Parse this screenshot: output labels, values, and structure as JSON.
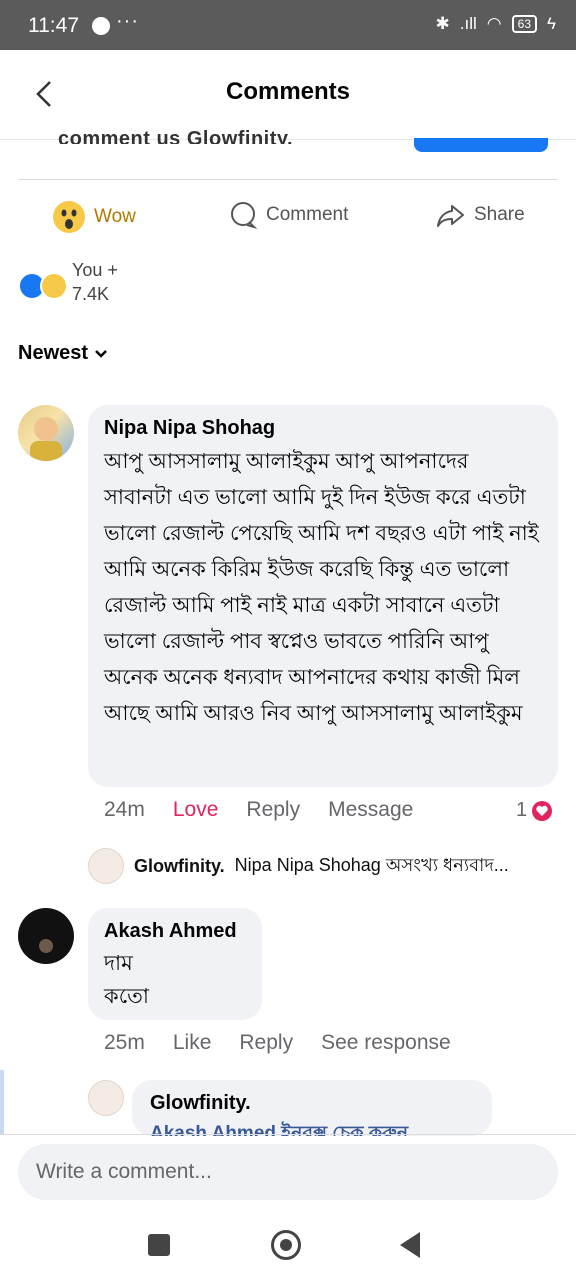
{
  "status_bar": {
    "time": "11:47",
    "extra": "···",
    "battery": "63",
    "signal_text": ".ıll"
  },
  "header": {
    "title": "Comments"
  },
  "post_cutoff": {
    "text": "comment us Glowfinity."
  },
  "post_actions": {
    "reaction_label": "Wow",
    "comment_label": "Comment",
    "share_label": "Share"
  },
  "reactions": {
    "line1": "You +",
    "line2": "7.4K"
  },
  "sort": {
    "label": "Newest"
  },
  "comments": [
    {
      "author": "Nipa Nipa Shohag",
      "text": "আপু আসসালামু আলাইকুম আপু আপনাদের সাবানটা এত ভালো আমি দুই দিন ইউজ করে এতটা ভালো রেজাল্ট পেয়েছি আমি দশ বছরও এটা পাই নাই আমি অনেক কিরিম ইউজ করেছি কিন্তু এত ভালো রেজাল্ট আমি পাই নাই মাত্র একটা সাবানে এতটা ভালো রেজাল্ট পাব স্বপ্নেও ভাবতে পারিনি আপু অনেক অনেক ধন্যবাদ আপনাদের কথায় কাজী মিল আছে আমি আরও নিব আপু আসসালামু আলাইকুম",
      "time": "24m",
      "reaction": "Love",
      "reply": "Reply",
      "message": "Message",
      "reaction_count": "1",
      "page_reply": {
        "page": "Glowfinity.",
        "text": "Nipa Nipa Shohag অসংখ্য ধন্যবাদ..."
      }
    },
    {
      "author": "Akash Ahmed",
      "text": "দাম\nকতো",
      "time": "25m",
      "like": "Like",
      "reply": "Reply",
      "see_response": "See response",
      "page_reply": {
        "page": "Glowfinity.",
        "text": "Akash Ahmed ইনবক্স চেক করুন"
      }
    }
  ],
  "composer": {
    "placeholder": "Write a comment..."
  },
  "colors": {
    "accent": "#1877f2",
    "love": "#e0245e",
    "bubble": "#f0f2f5"
  }
}
